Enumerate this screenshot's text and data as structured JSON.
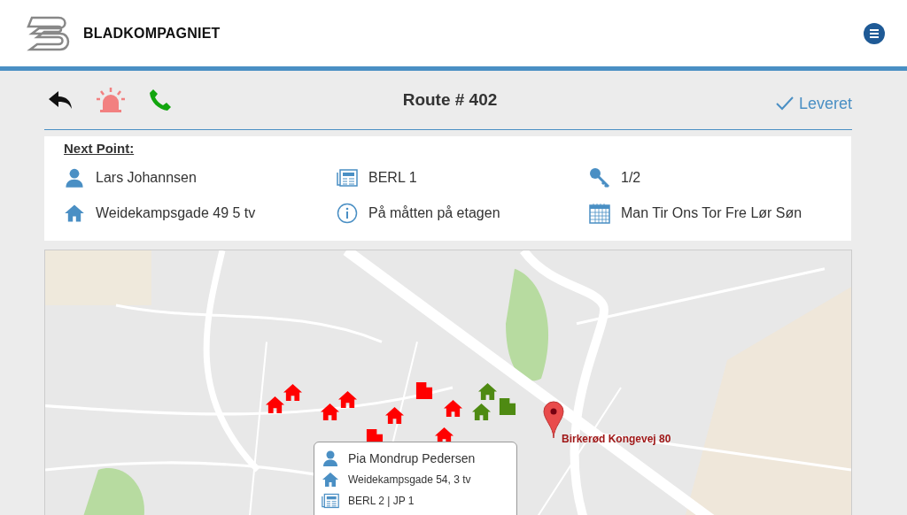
{
  "header": {
    "brand": "BLADKOMPAGNIET"
  },
  "toolbar": {
    "title": "Route # 402",
    "delivered_button": "Leveret"
  },
  "next_point": {
    "heading": "Next Point:",
    "fields": [
      {
        "kind": "person",
        "text": "Lars Johannsen"
      },
      {
        "kind": "newspaper",
        "text": "BERL 1"
      },
      {
        "kind": "key",
        "text": "1/2"
      },
      {
        "kind": "house",
        "text": "Weidekampsgade 49 5 tv"
      },
      {
        "kind": "info",
        "text": "På måtten på etagen"
      },
      {
        "kind": "calendar",
        "text": "Man Tir Ons Tor Fre Lør Søn"
      }
    ]
  },
  "map": {
    "kind": "picture",
    "markers": [
      {
        "kind": "house",
        "color": "#ff0000"
      },
      {
        "kind": "house",
        "color": "#ff0000"
      },
      {
        "kind": "house",
        "color": "#ff0000"
      },
      {
        "kind": "house",
        "color": "#ff0000"
      },
      {
        "kind": "house",
        "color": "#ff0000"
      },
      {
        "kind": "house",
        "color": "#ff0000"
      },
      {
        "kind": "house",
        "color": "#ff0000"
      },
      {
        "kind": "building",
        "color": "#ff0000"
      },
      {
        "kind": "building",
        "color": "#ff0000"
      },
      {
        "kind": "house",
        "color": "#4e8a12"
      },
      {
        "kind": "house",
        "color": "#4e8a12"
      },
      {
        "kind": "building",
        "color": "#4e8a12"
      }
    ],
    "destination": {
      "label": "Birkerød Kongevej 80"
    },
    "popup": {
      "rows": [
        {
          "kind": "person",
          "text": "Pia Mondrup Pedersen"
        },
        {
          "kind": "house",
          "text": "Weidekampsgade 54, 3 tv"
        },
        {
          "kind": "newspaper",
          "text": "BERL 2 | JP 1"
        }
      ]
    }
  }
}
